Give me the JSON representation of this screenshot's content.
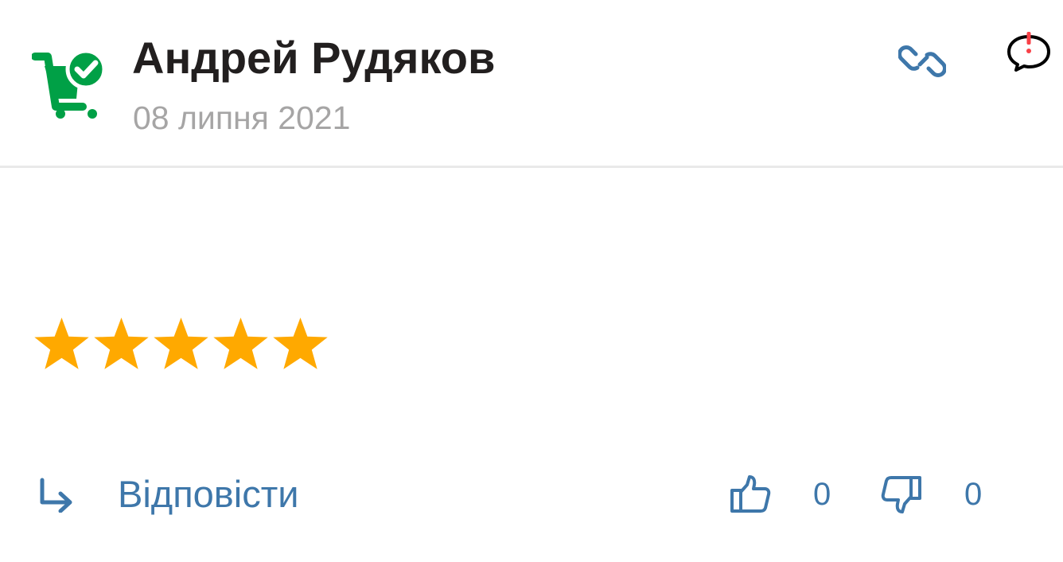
{
  "review": {
    "author_name": "Андрей Рудяков",
    "date": "08 липня 2021",
    "rating": 5,
    "rating_max": 5,
    "avatar_icon": "cart-check-icon",
    "reply_label": "Відповісти",
    "likes": "0",
    "dislikes": "0"
  },
  "icons": {
    "link": "link-icon",
    "complain": "complaint-icon",
    "reply": "reply-arrow-icon",
    "like": "thumbs-up-icon",
    "dislike": "thumbs-down-icon",
    "star": "star-icon"
  },
  "colors": {
    "brand_green": "#00a046",
    "star": "#ffa900",
    "link_blue": "#3e77aa",
    "author_text": "#221f1f",
    "date_text": "#a6a5a5",
    "alert_red": "#f84147",
    "divider": "#e9e9e9"
  }
}
